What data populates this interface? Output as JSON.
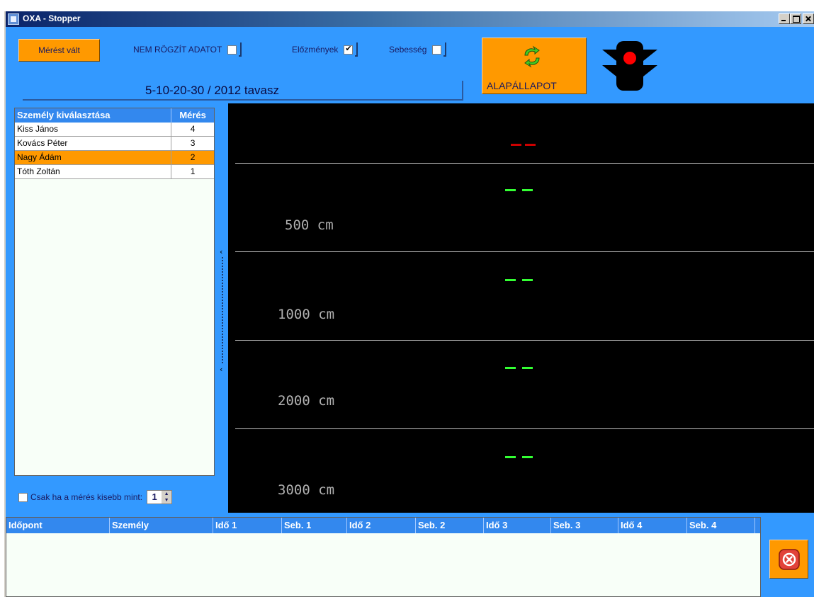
{
  "window": {
    "title": "OXA - Stopper"
  },
  "toolbar": {
    "switch_measurement_label": "Mérést vált",
    "no_record_label": "NEM RÖGZÍT ADATOT",
    "no_record_checked": false,
    "history_label": "Előzmények",
    "history_checked": true,
    "speed_label": "Sebesség",
    "speed_checked": false,
    "session": "5-10-20-30 / 2012 tavasz",
    "reset_label": "ALAPÁLLAPOT",
    "traffic_light_state": "red"
  },
  "person_list": {
    "headers": {
      "name": "Személy kiválasztása",
      "count": "Mérés"
    },
    "rows": [
      {
        "name": "Kiss János",
        "count": "4",
        "selected": false
      },
      {
        "name": "Kovács Péter",
        "count": "3",
        "selected": false
      },
      {
        "name": "Nagy Ádám",
        "count": "2",
        "selected": true
      },
      {
        "name": "Tóth Zoltán",
        "count": "1",
        "selected": false
      }
    ]
  },
  "filter": {
    "label": "Csak ha a mérés kisebb mint:",
    "checked": false,
    "value": "1"
  },
  "display": {
    "start_indicator_color": "#cc0000",
    "split_indicator_color": "#33ff33",
    "distances": [
      "500 cm",
      "1000 cm",
      "2000 cm",
      "3000 cm"
    ]
  },
  "results": {
    "columns": [
      "Időpont",
      "Személy",
      "Idő 1",
      "Seb. 1",
      "Idő 2",
      "Seb. 2",
      "Idő 3",
      "Seb. 3",
      "Idő 4",
      "Seb. 4"
    ],
    "rows": []
  },
  "colors": {
    "accent": "#ff9900",
    "background": "#3399ff",
    "header": "#3388ee"
  }
}
